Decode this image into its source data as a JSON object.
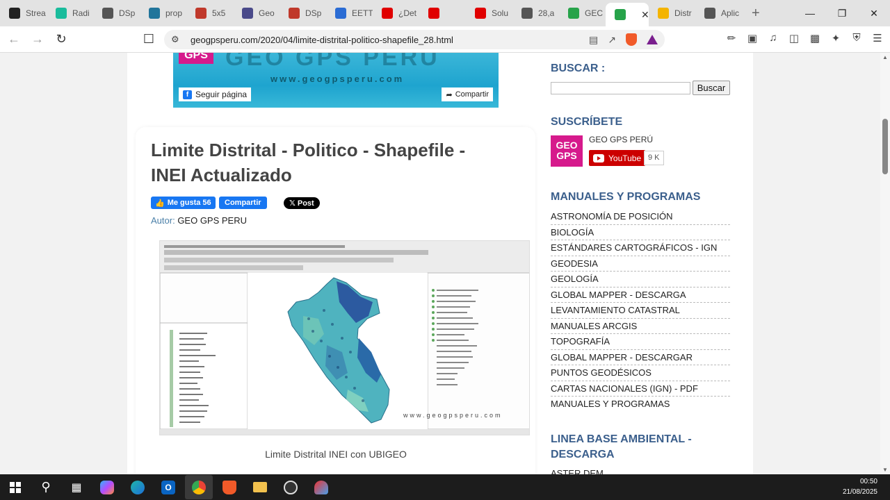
{
  "browser": {
    "tabs": [
      {
        "title": "Strea",
        "icon": "stream-icon",
        "color": "#222222"
      },
      {
        "title": "Radi",
        "icon": "radio-icon",
        "color": "#1abc9c"
      },
      {
        "title": "DSp",
        "icon": "dspace-icon",
        "color": "#555555"
      },
      {
        "title": "prop",
        "icon": "wordpress-icon",
        "color": "#21759b"
      },
      {
        "title": "5x5",
        "icon": "5x5-icon",
        "color": "#c0392b"
      },
      {
        "title": "Geo",
        "icon": "geo-icon",
        "color": "#4a4a8a"
      },
      {
        "title": "DSp",
        "icon": "dspace-shield-icon",
        "color": "#c0392b"
      },
      {
        "title": "EETT",
        "icon": "document-icon",
        "color": "#2b6cd4"
      },
      {
        "title": "¿Det",
        "icon": "youtube-icon",
        "color": "#e00000"
      },
      {
        "title": "",
        "icon": "youtube-green-icon",
        "color": "#e00000"
      },
      {
        "title": "Solu",
        "icon": "youtube-icon",
        "color": "#e00000"
      },
      {
        "title": "28,a",
        "icon": "globe-icon",
        "color": "#555555"
      },
      {
        "title": "GEC",
        "icon": "geo-gps-icon",
        "color": "#27a34a"
      },
      {
        "title": "",
        "icon": "geo-gps-icon",
        "color": "#27a34a",
        "active": true
      },
      {
        "title": "Distr",
        "icon": "drive-icon",
        "color": "#f4b400"
      },
      {
        "title": "Aplic",
        "icon": "globe-icon",
        "color": "#555555"
      }
    ],
    "url": "geogpsperu.com/2020/04/limite-distrital-politico-shapefile_28.html"
  },
  "banner": {
    "logo_text": "GPS",
    "title": "GEO GPS PERU",
    "website": "www.geogpsperu.com",
    "follow_label": "Seguir página",
    "share_label": "Compartir"
  },
  "post": {
    "title": "Limite Distrital - Politico - Shapefile - INEI Actualizado",
    "like_label": "Me gusta 56",
    "share_label": "Compartir",
    "xpost_label": "Post",
    "author_label": "Autor:",
    "author_name": "GEO GPS PERU",
    "image_watermark": "www.geogpsperu.com",
    "caption": "Limite Distrital INEI con UBIGEO"
  },
  "sidebar": {
    "search_heading": "BUSCAR :",
    "search_button": "Buscar",
    "subscribe_heading": "SUSCRÍBETE",
    "channel_logo": "GEO GPS",
    "channel_name": "GEO GPS PERÚ",
    "youtube_label": "YouTube",
    "subscriber_count": "9 K",
    "manuals_heading": "MANUALES Y PROGRAMAS",
    "manuals": [
      "ASTRONOMÍA DE POSICIÓN",
      "BIOLOGÍA",
      "ESTÁNDARES CARTOGRÁFICOS - IGN",
      "GEODESIA",
      "GEOLOGÍA",
      "GLOBAL MAPPER - DESCARGA",
      "LEVANTAMIENTO CATASTRAL",
      "MANUALES ARCGIS",
      "TOPOGRAFÍA",
      "GLOBAL MAPPER - DESCARGAR",
      "PUNTOS GEODÉSICOS",
      "CARTAS NACIONALES (IGN) - PDF",
      "MANUALES Y PROGRAMAS"
    ],
    "baseline_heading": "LINEA BASE AMBIENTAL - DESCARGA",
    "baseline_first": "ASTER DEM"
  },
  "taskbar": {
    "time": "00:50",
    "date": "21/08/2025"
  }
}
